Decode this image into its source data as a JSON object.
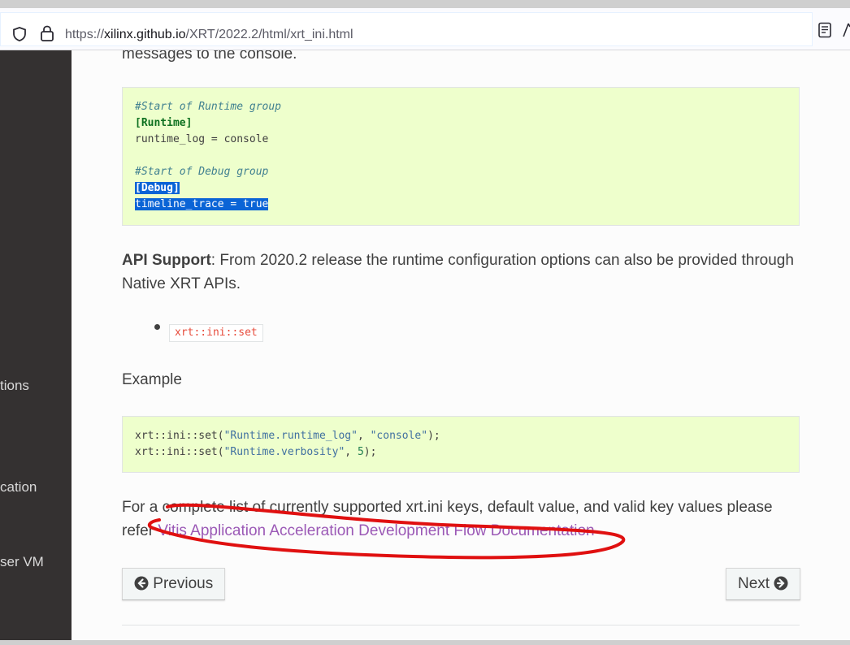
{
  "browser": {
    "url_prefix": "https://",
    "url_host": "xilinx.github.io",
    "url_path": "/XRT/2022.2/html/xrt_ini.html"
  },
  "sidebar": {
    "items": [
      {
        "label": "tions"
      },
      {
        "label": "cation"
      },
      {
        "label": "ser VM"
      }
    ]
  },
  "content": {
    "cutoff_text": "messages to the console.",
    "code1": {
      "l1": "#Start of Runtime group",
      "l2": "[Runtime]",
      "l3": "runtime_log = console",
      "l5": "#Start of Debug group",
      "l6": "[Debug]",
      "l7": "timeline_trace = true"
    },
    "api_label": "API Support",
    "api_text": ": From 2020.2 release the runtime configuration options can also be provided through Native XRT APIs.",
    "api_item": "xrt::ini::set",
    "example_label": "Example",
    "code2": {
      "l1_fn": "xrt::ini::set(",
      "l1_str": "\"Runtime.runtime_log\"",
      "l1_mid": ", ",
      "l1_str2": "\"console\"",
      "l1_end": ");",
      "l2_fn": "xrt::ini::set(",
      "l2_str": "\"Runtime.verbosity\"",
      "l2_mid": ", ",
      "l2_num": "5",
      "l2_end": ");"
    },
    "complete_text": "For a complete list of currently supported xrt.ini keys, default value, and valid key values please refer ",
    "complete_link": "Vitis Application Acceleration Development Flow Documentation"
  },
  "nav": {
    "previous": "Previous",
    "next": "Next"
  },
  "colors": {
    "sidebar_bg": "#343131",
    "code_bg": "#eeffcc",
    "link": "#9b59b6",
    "annotation": "#e01010",
    "selection": "#0a64d6"
  }
}
